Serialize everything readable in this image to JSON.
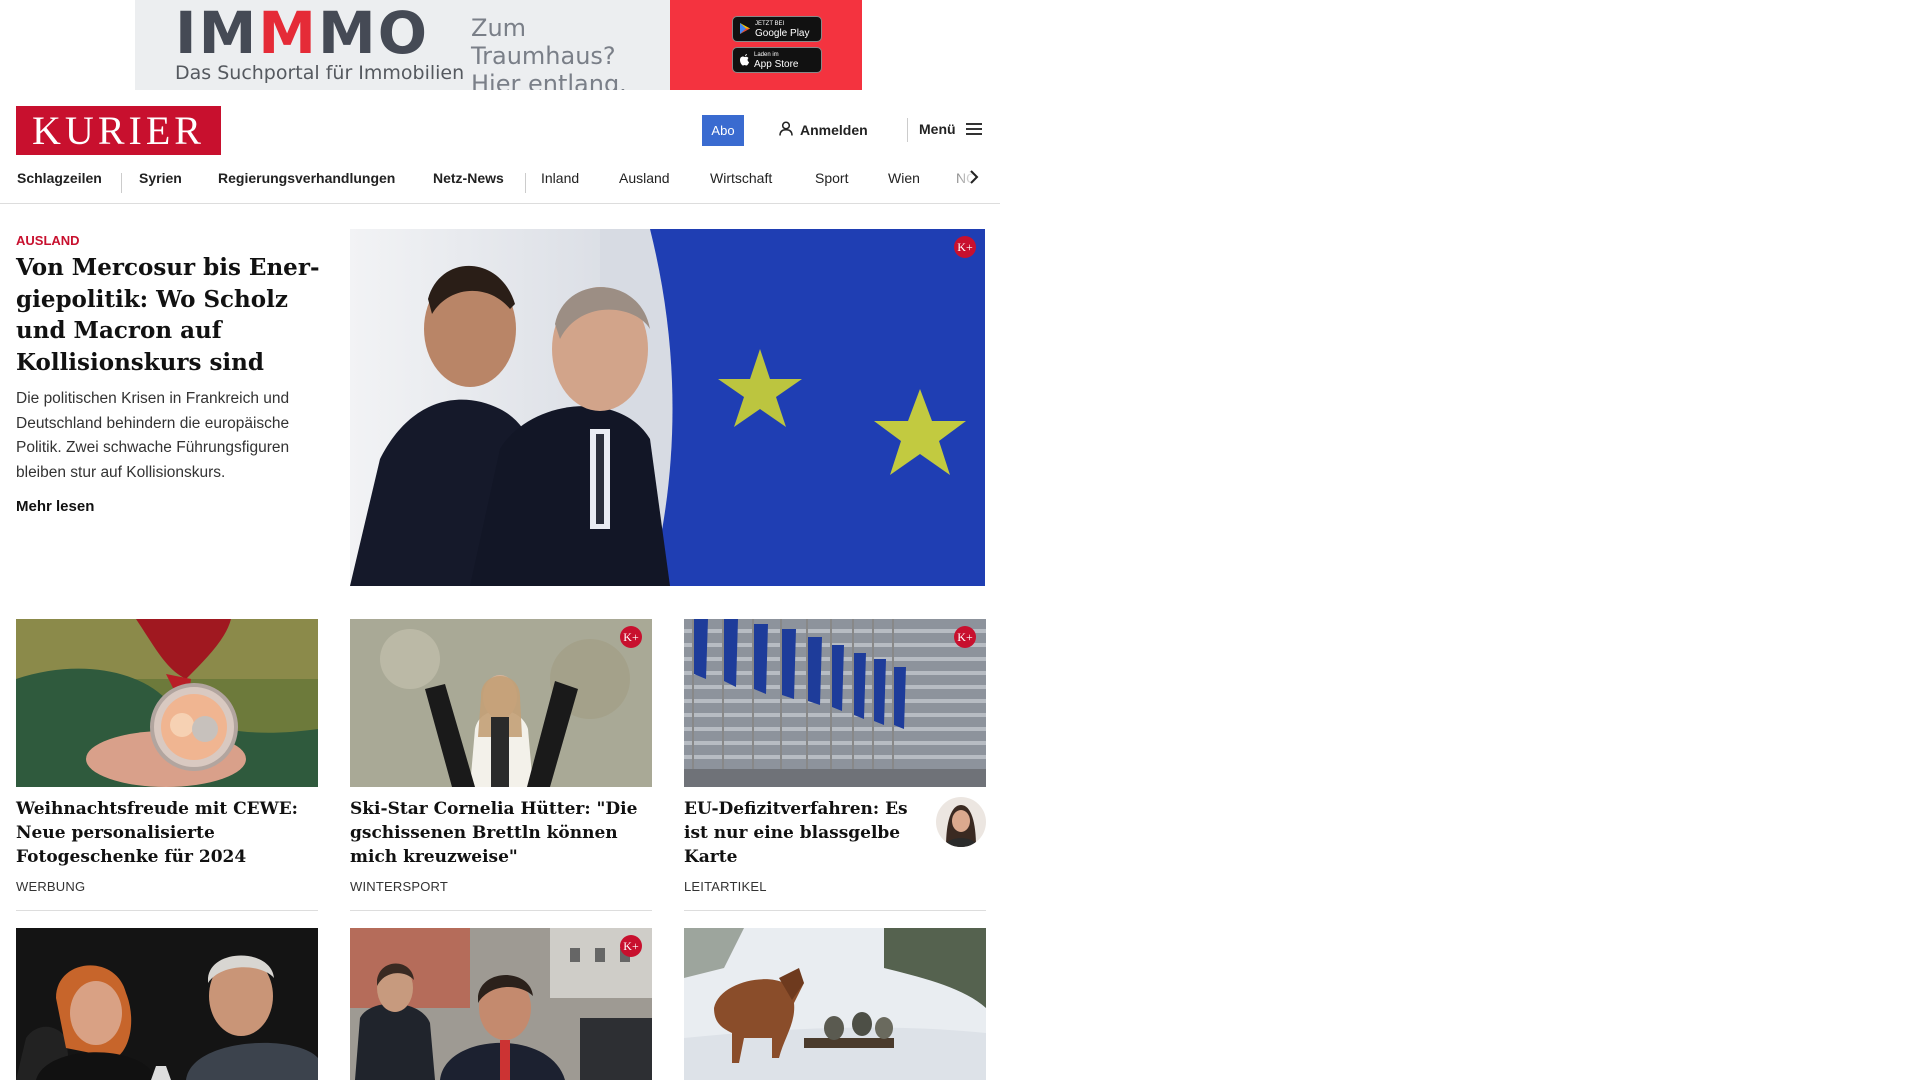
{
  "ad": {
    "logo_pre": "IM",
    "logo_mid": "M",
    "logo_post": "MO",
    "tagline": "Das Suchportal für Immobilien",
    "slogan_line1": "Zum Traumhaus?",
    "slogan_line2": "Hier entlang.",
    "google_small": "JETZT BEI",
    "google_big": "Google Play",
    "apple_small": "Laden im",
    "apple_big": "App Store"
  },
  "header": {
    "logo": "KURIER",
    "abo": "Abo",
    "login": "Anmelden",
    "menu": "Menü"
  },
  "nav": {
    "items": [
      "Schlagzeilen",
      "Syrien",
      "Regierungsverhandlungen",
      "Netz-News",
      "Inland",
      "Ausland",
      "Wirtschaft",
      "Sport",
      "Wien",
      "NÖ"
    ]
  },
  "lead": {
    "kicker": "AUSLAND",
    "title": "Von Mercosur bis Ener­giepolitik: Wo Scholz und Macron auf Kollisions­kurs sind",
    "teaser": "Die politischen Krisen in Frankreich und Deutschland behindern die europäische Politik. Zwei schwache Führungsfiguren bleiben stur auf Kollisionskurs.",
    "more": "Mehr lesen",
    "badge": "K+"
  },
  "cards": [
    {
      "title": "Weihnachtsfreude mit CEWE: Neue personalisierte Fotogeschenke für 2024",
      "category": "WERBUNG"
    },
    {
      "title": "Ski-Star Cornelia Hütter: \"Die gschissenen Brettln können mich kreuzweise\"",
      "category": "WINTERSPORT",
      "badge": "K+"
    },
    {
      "title": "EU-Defizitverfahren: Es ist nur eine blassgelbe Karte",
      "category": "LEITARTIKEL",
      "badge": "K+"
    }
  ],
  "row2_badge": "K+",
  "colors": {
    "brand_red": "#c8102e",
    "abo_blue": "#3a6bd0",
    "ad_red": "#f4333f"
  }
}
